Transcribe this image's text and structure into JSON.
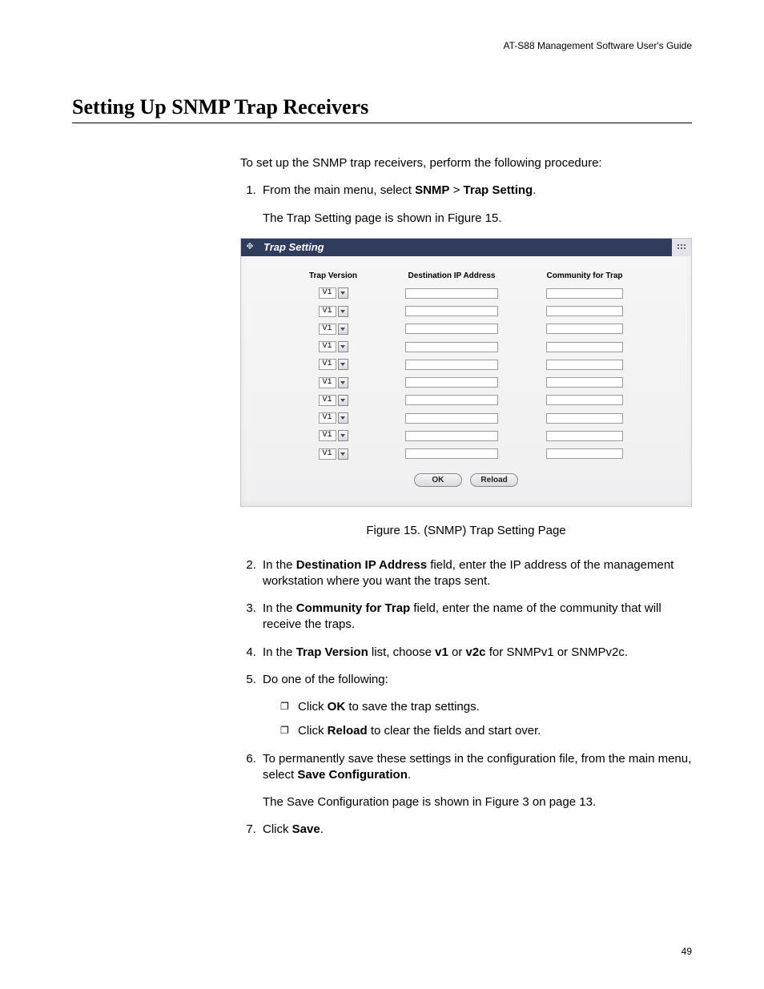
{
  "doc_header": "AT-S88 Management Software User's Guide",
  "heading": "Setting Up SNMP Trap Receivers",
  "intro": "To set up the SNMP trap receivers, perform the following procedure:",
  "steps": {
    "s1_pre": "From the main menu, select ",
    "s1_b1": "SNMP",
    "s1_mid": " > ",
    "s1_b2": "Trap Setting",
    "s1_post": ".",
    "s1_after": "The Trap Setting page is shown in Figure 15.",
    "s2_pre": "In the ",
    "s2_b": "Destination IP Address",
    "s2_post": " field, enter the IP address of the management workstation where you want the traps sent.",
    "s3_pre": "In the ",
    "s3_b": "Community for Trap",
    "s3_post": " field, enter the name of the community that will receive the traps.",
    "s4_pre": "In the ",
    "s4_b1": "Trap Version",
    "s4_mid1": " list, choose ",
    "s4_b2": "v1",
    "s4_mid2": " or ",
    "s4_b3": "v2c",
    "s4_post": " for SNMPv1 or SNMPv2c.",
    "s5": "Do one of the following:",
    "s5a_pre": "Click ",
    "s5a_b": "OK",
    "s5a_post": " to save the trap settings.",
    "s5b_pre": "Click ",
    "s5b_b": "Reload",
    "s5b_post": " to clear the fields and start over.",
    "s6_pre": "To permanently save these settings in the configuration file, from the main menu, select ",
    "s6_b": "Save Configuration",
    "s6_post": ".",
    "s6_after": "The Save Configuration page is shown in Figure 3 on page 13.",
    "s7_pre": "Click ",
    "s7_b": "Save",
    "s7_post": "."
  },
  "figure": {
    "title": "Trap Setting",
    "columns": {
      "version": "Trap Version",
      "dest": "Destination IP Address",
      "community": "Community for Trap"
    },
    "row_value": "V1",
    "buttons": {
      "ok": "OK",
      "reload": "Reload"
    },
    "caption": "Figure 15. (SNMP) Trap Setting Page"
  },
  "page_number": "49"
}
